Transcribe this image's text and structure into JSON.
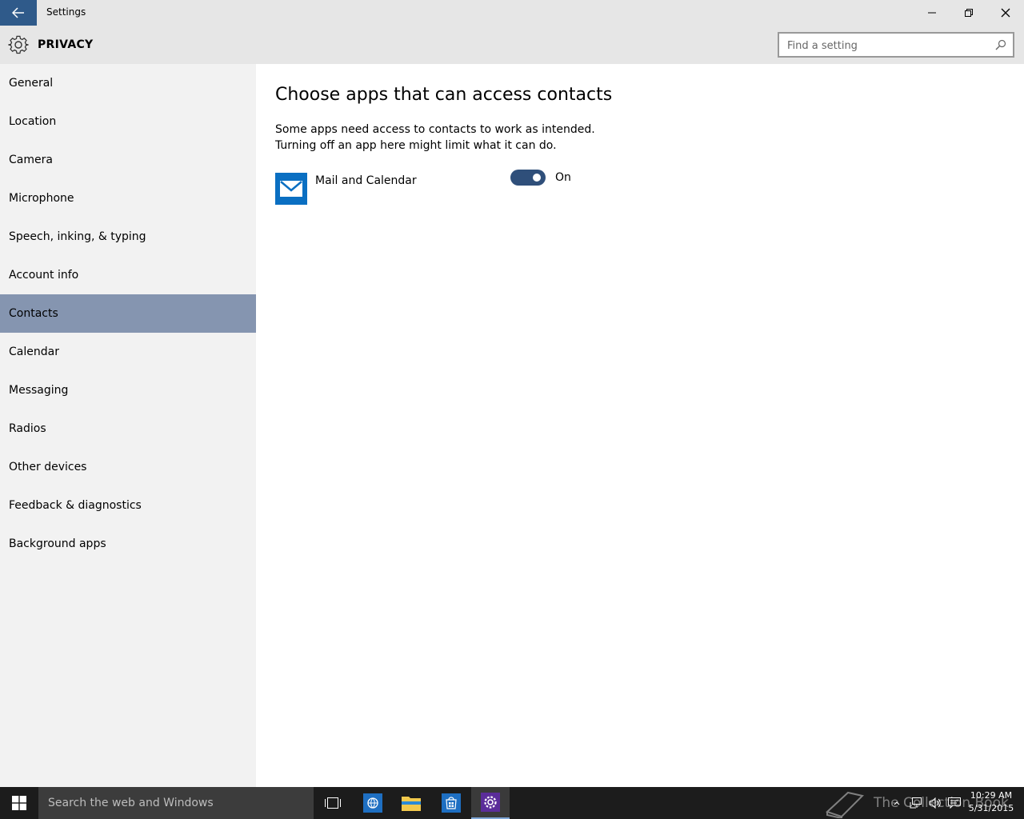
{
  "window": {
    "title": "Settings",
    "section": "PRIVACY",
    "search_placeholder": "Find a setting"
  },
  "sidebar": {
    "items": [
      {
        "label": "General"
      },
      {
        "label": "Location"
      },
      {
        "label": "Camera"
      },
      {
        "label": "Microphone"
      },
      {
        "label": "Speech, inking, & typing"
      },
      {
        "label": "Account info"
      },
      {
        "label": "Contacts",
        "selected": true
      },
      {
        "label": "Calendar"
      },
      {
        "label": "Messaging"
      },
      {
        "label": "Radios"
      },
      {
        "label": "Other devices"
      },
      {
        "label": "Feedback & diagnostics"
      },
      {
        "label": "Background apps"
      }
    ]
  },
  "content": {
    "title": "Choose apps that can access contacts",
    "description": "Some apps need access to contacts to work as intended. Turning off an app here might limit what it can do.",
    "apps": [
      {
        "name": "Mail and Calendar",
        "icon": "mail-icon",
        "enabled": true,
        "state_label": "On"
      }
    ]
  },
  "taskbar": {
    "search_placeholder": "Search the web and Windows",
    "watermark": "The Collection Book",
    "time": "10:29 AM",
    "date": "5/31/2015",
    "pinned": [
      "task-view-icon",
      "internet-explorer-icon",
      "file-explorer-icon",
      "store-icon",
      "settings-icon"
    ]
  },
  "colors": {
    "accent": "#2f5a8a",
    "selected_nav": "#8595b0",
    "toggle_on": "#2f4f7a",
    "mail_tile": "#0a6fc2"
  }
}
